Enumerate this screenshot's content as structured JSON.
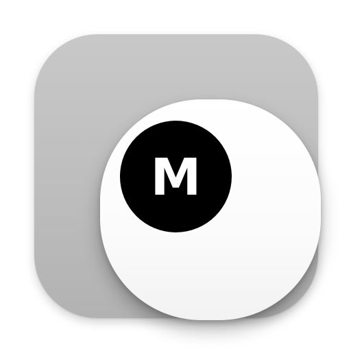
{
  "app_icon": {
    "letter": "M",
    "colors": {
      "tile": "#bdbdbd",
      "button": "#ffffff",
      "badge": "#000000",
      "letter": "#ffffff"
    }
  }
}
